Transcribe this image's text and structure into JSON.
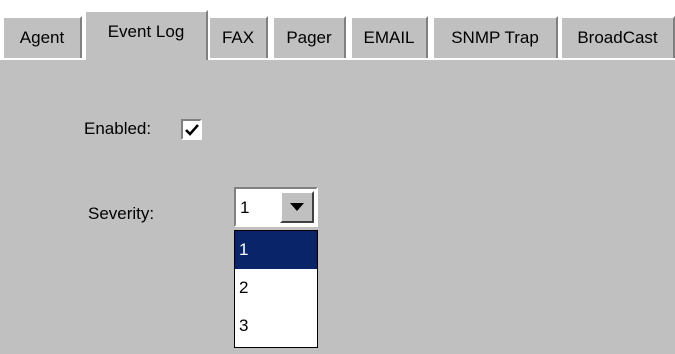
{
  "tabs": [
    {
      "label": "Agent",
      "active": false
    },
    {
      "label": "Event Log",
      "active": true
    },
    {
      "label": "FAX",
      "active": false
    },
    {
      "label": "Pager",
      "active": false
    },
    {
      "label": "EMAIL",
      "active": false
    },
    {
      "label": "SNMP Trap",
      "active": false
    },
    {
      "label": "BroadCast",
      "active": false
    }
  ],
  "form": {
    "enabled_label": "Enabled:",
    "enabled_checked": true,
    "severity_label": "Severity:",
    "severity_value": "1",
    "severity_options": [
      {
        "label": "1",
        "selected": true
      },
      {
        "label": "2",
        "selected": false
      },
      {
        "label": "3",
        "selected": false
      }
    ]
  },
  "colors": {
    "panel_bg": "#c0c0c0",
    "selection_bg": "#0a246a"
  },
  "icons": {
    "checkbox_mark": "checkmark-icon",
    "dropdown": "chevron-down-icon"
  }
}
